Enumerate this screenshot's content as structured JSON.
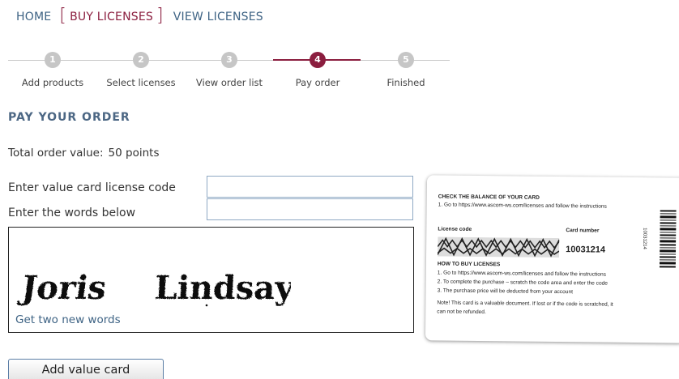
{
  "nav": {
    "home": "HOME",
    "buy": "BUY LICENSES",
    "view": "VIEW LICENSES"
  },
  "steps": [
    {
      "num": "1",
      "label": "Add products"
    },
    {
      "num": "2",
      "label": "Select licenses"
    },
    {
      "num": "3",
      "label": "View order list"
    },
    {
      "num": "4",
      "label": "Pay order"
    },
    {
      "num": "5",
      "label": "Finished"
    }
  ],
  "current_step": 4,
  "page_title": "PAY YOUR ORDER",
  "order": {
    "label": "Total order value:",
    "value": "50 points"
  },
  "form": {
    "code_label": "Enter value card license code",
    "code_value": "",
    "words_label": "Enter the words below",
    "words_value": ""
  },
  "captcha": {
    "word1": "Joris",
    "word2": "Lindsay",
    "refresh_link": "Get two new words"
  },
  "add_button": "Add value card",
  "card": {
    "balance_title": "CHECK THE BALANCE OF YOUR CARD",
    "balance_step": "1. Go to https://www.ascom-ws.com/licenses and follow the instructions",
    "license_code_label": "License code",
    "card_number_label": "Card number",
    "card_number": "10031214",
    "howto_title": "HOW TO BUY LICENSES",
    "howto_1": "1. Go to https://www.ascom-ws.com/licenses and follow the instructions",
    "howto_2": "2. To complete the purchase – scratch the code area and enter the code",
    "howto_3": "3. The purchase price will be deducted from your account",
    "note_1": "Note! This card is a valuable document. If lost or if the code is scratched, it",
    "note_2": "can not be refunded.",
    "vertical_number": "10031214"
  },
  "colors": {
    "accent": "#8b1e3f",
    "link": "#3e6384",
    "title": "#4c6784",
    "step_inactive": "#c6c6c6"
  }
}
